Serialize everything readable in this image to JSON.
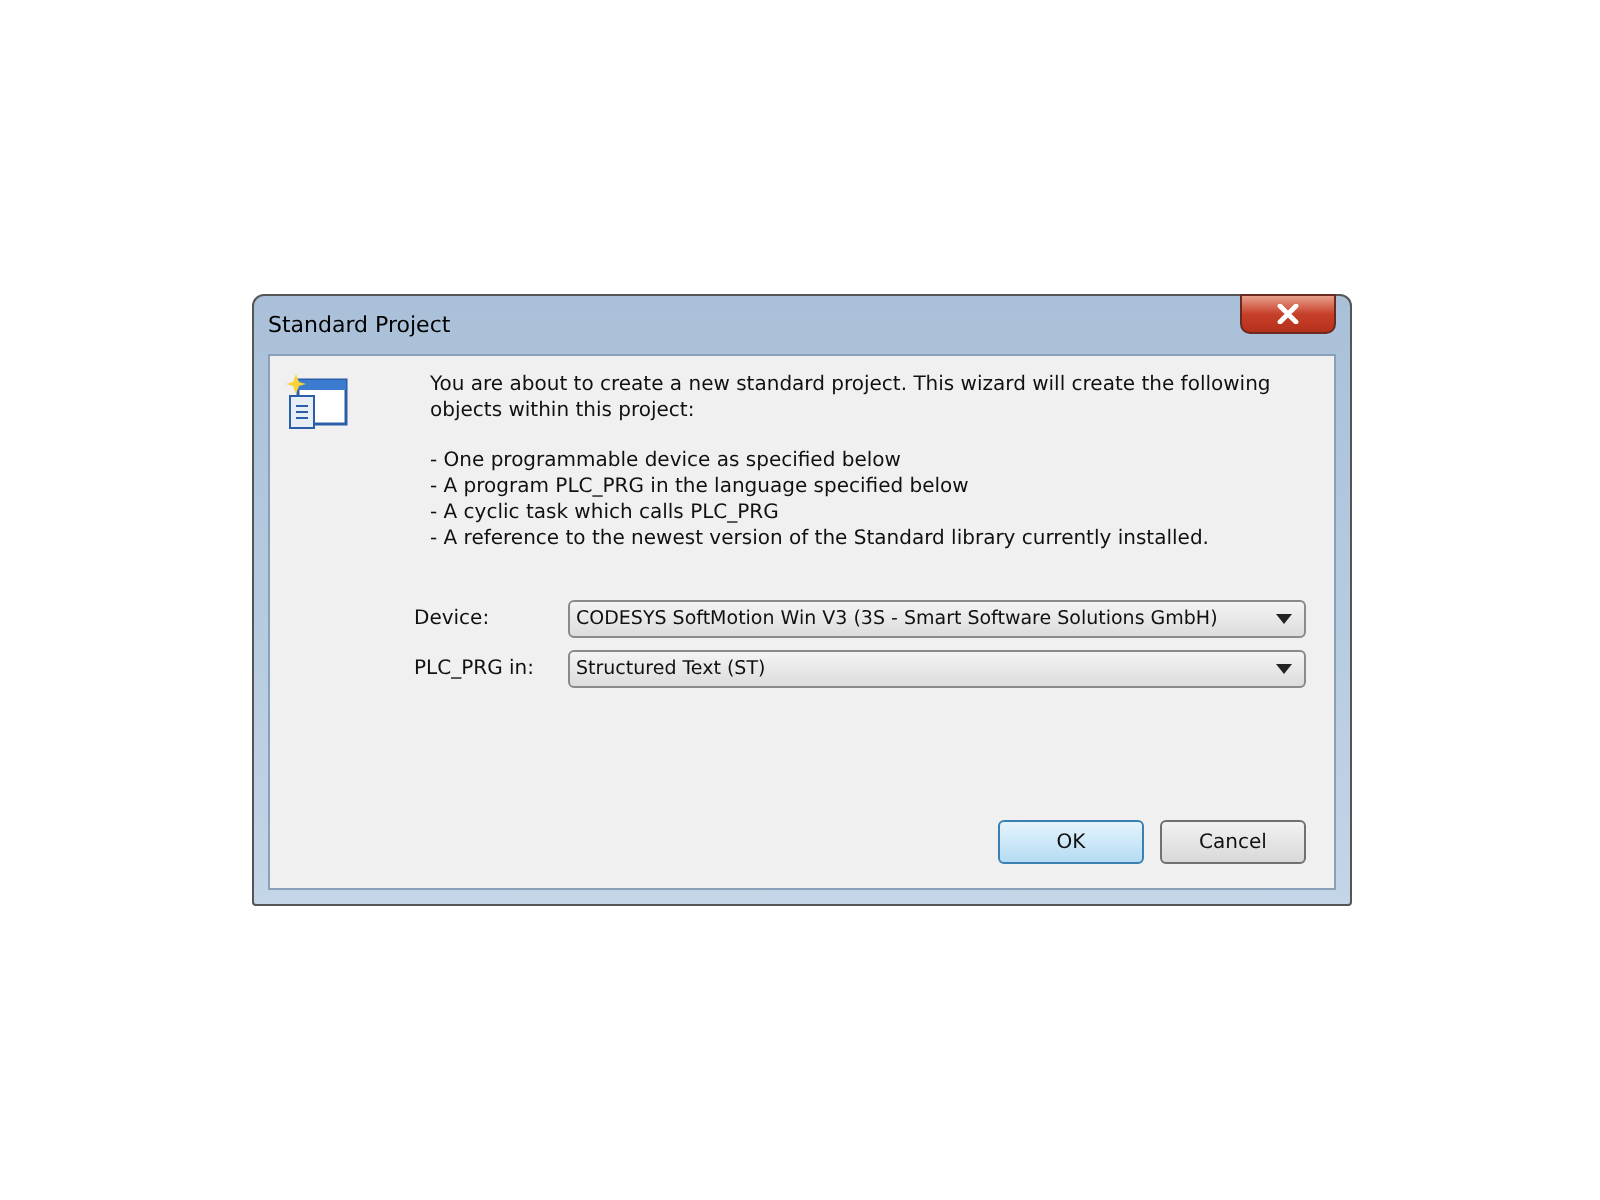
{
  "window": {
    "title": "Standard Project"
  },
  "intro": "You are about to create a new standard project. This wizard will create the following objects within this project:",
  "bullets": [
    "- One programmable device as specified below",
    "- A program PLC_PRG in the language specified below",
    "- A cyclic task which calls PLC_PRG",
    "- A reference to the newest version of the Standard library currently installed."
  ],
  "fields": [
    {
      "label": "Device:",
      "value": "CODESYS SoftMotion Win V3 (3S - Smart Software Solutions GmbH)"
    },
    {
      "label": "PLC_PRG in:",
      "value": "Structured Text (ST)"
    }
  ],
  "buttons": [
    {
      "label": "OK",
      "default": true
    },
    {
      "label": "Cancel",
      "default": false
    }
  ]
}
